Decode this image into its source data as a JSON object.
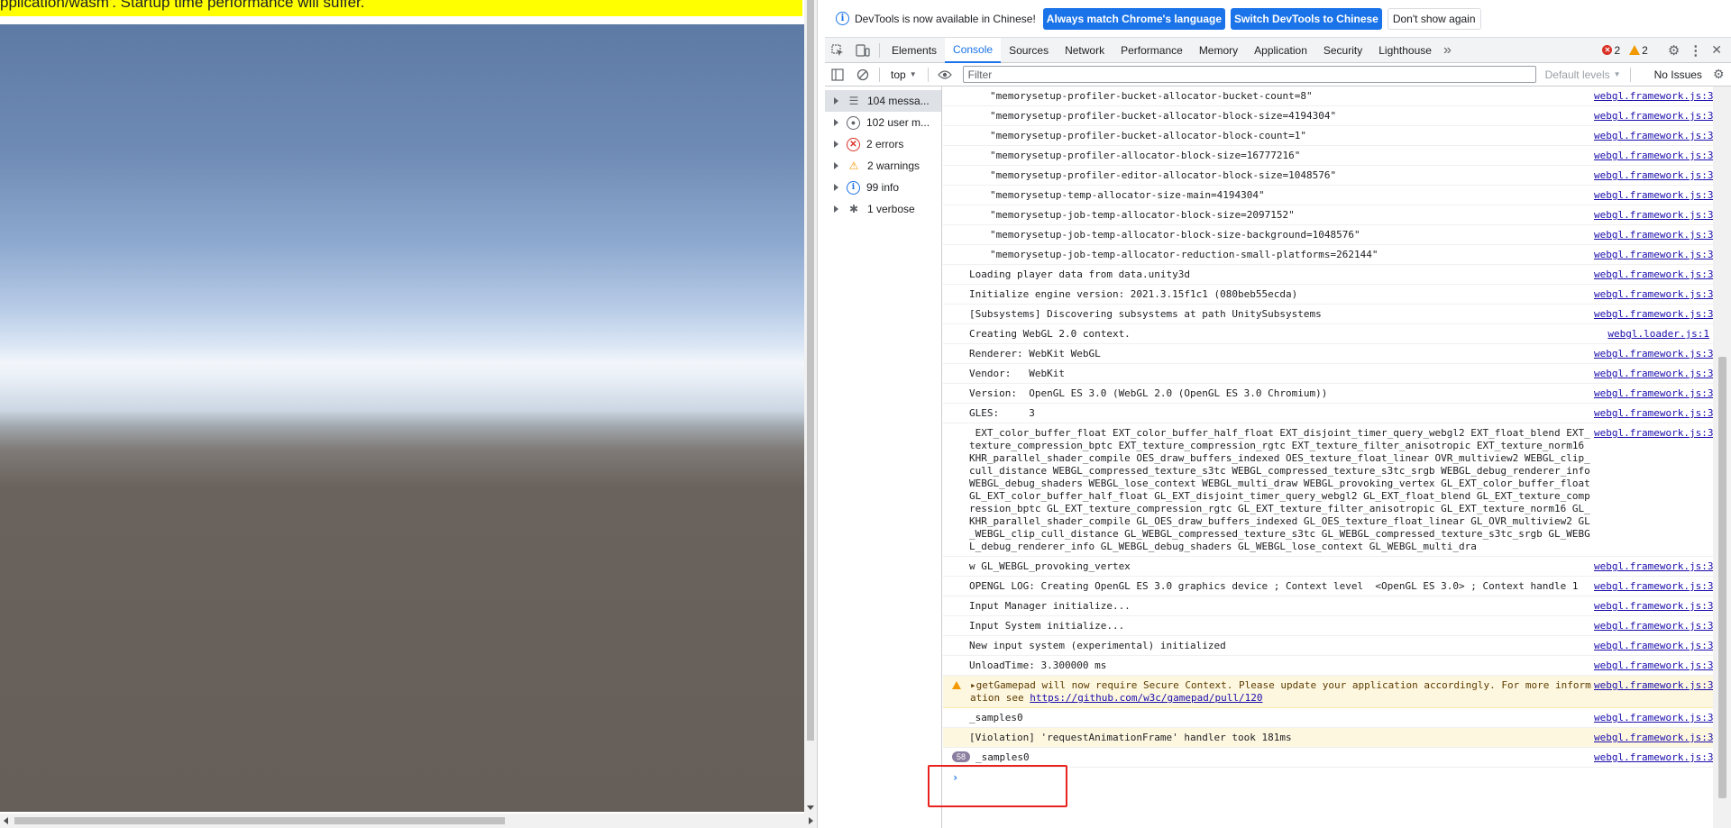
{
  "game": {
    "warning_text": "pplication/wasm'. Startup time performance will suffer."
  },
  "infobar": {
    "message": "DevTools is now available in Chinese!",
    "btn_match": "Always match Chrome's language",
    "btn_switch": "Switch DevTools to Chinese",
    "btn_dismiss": "Don't show again"
  },
  "tabs": [
    "Elements",
    "Console",
    "Sources",
    "Network",
    "Performance",
    "Memory",
    "Application",
    "Security",
    "Lighthouse"
  ],
  "tab_overflow": "»",
  "error_count": "2",
  "warning_count": "2",
  "toolbar": {
    "context": "top",
    "filter_placeholder": "Filter",
    "levels": "Default levels",
    "issues": "No Issues"
  },
  "sidebar": [
    {
      "label": "104 messa...",
      "icon": "list-icon"
    },
    {
      "label": "102 user m...",
      "icon": "user-icon"
    },
    {
      "label": "2 errors",
      "icon": "error-icon"
    },
    {
      "label": "2 warnings",
      "icon": "warning-icon"
    },
    {
      "label": "99 info",
      "icon": "info-icon"
    },
    {
      "label": "1 verbose",
      "icon": "bug-icon"
    }
  ],
  "console": {
    "rows": [
      {
        "msg": "\"memorysetup-profiler-bucket-allocator-bucket-count=8\"",
        "src": "webgl.framework.js:3",
        "indent": true
      },
      {
        "msg": "\"memorysetup-profiler-bucket-allocator-block-size=4194304\"",
        "src": "webgl.framework.js:3",
        "indent": true
      },
      {
        "msg": "\"memorysetup-profiler-bucket-allocator-block-count=1\"",
        "src": "webgl.framework.js:3",
        "indent": true
      },
      {
        "msg": "\"memorysetup-profiler-allocator-block-size=16777216\"",
        "src": "webgl.framework.js:3",
        "indent": true
      },
      {
        "msg": "\"memorysetup-profiler-editor-allocator-block-size=1048576\"",
        "src": "webgl.framework.js:3",
        "indent": true
      },
      {
        "msg": "\"memorysetup-temp-allocator-size-main=4194304\"",
        "src": "webgl.framework.js:3",
        "indent": true
      },
      {
        "msg": "\"memorysetup-job-temp-allocator-block-size=2097152\"",
        "src": "webgl.framework.js:3",
        "indent": true
      },
      {
        "msg": "\"memorysetup-job-temp-allocator-block-size-background=1048576\"",
        "src": "webgl.framework.js:3",
        "indent": true
      },
      {
        "msg": "\"memorysetup-job-temp-allocator-reduction-small-platforms=262144\"",
        "src": "webgl.framework.js:3",
        "indent": true
      },
      {
        "msg": "Loading player data from data.unity3d",
        "src": "webgl.framework.js:3"
      },
      {
        "msg": "Initialize engine version: 2021.3.15f1c1 (080beb55ecda)",
        "src": "webgl.framework.js:3"
      },
      {
        "msg": "[Subsystems] Discovering subsystems at path UnitySubsystems",
        "src": "webgl.framework.js:3"
      },
      {
        "msg": "Creating WebGL 2.0 context.",
        "src": "webgl.loader.js:1"
      },
      {
        "msg": "Renderer: WebKit WebGL",
        "src": "webgl.framework.js:3"
      },
      {
        "msg": "Vendor:   WebKit",
        "src": "webgl.framework.js:3"
      },
      {
        "msg": "Version:  OpenGL ES 3.0 (WebGL 2.0 (OpenGL ES 3.0 Chromium))",
        "src": "webgl.framework.js:3"
      },
      {
        "msg": "GLES:     3",
        "src": "webgl.framework.js:3"
      },
      {
        "msg": " EXT_color_buffer_float EXT_color_buffer_half_float EXT_disjoint_timer_query_webgl2 EXT_float_blend EXT_texture_compression_bptc EXT_texture_compression_rgtc EXT_texture_filter_anisotropic EXT_texture_norm16 KHR_parallel_shader_compile OES_draw_buffers_indexed OES_texture_float_linear OVR_multiview2 WEBGL_clip_cull_distance WEBGL_compressed_texture_s3tc WEBGL_compressed_texture_s3tc_srgb WEBGL_debug_renderer_info WEBGL_debug_shaders WEBGL_lose_context WEBGL_multi_draw WEBGL_provoking_vertex GL_EXT_color_buffer_float GL_EXT_color_buffer_half_float GL_EXT_disjoint_timer_query_webgl2 GL_EXT_float_blend GL_EXT_texture_compression_bptc GL_EXT_texture_compression_rgtc GL_EXT_texture_filter_anisotropic GL_EXT_texture_norm16 GL_KHR_parallel_shader_compile GL_OES_draw_buffers_indexed GL_OES_texture_float_linear GL_OVR_multiview2 GL_WEBGL_clip_cull_distance GL_WEBGL_compressed_texture_s3tc GL_WEBGL_compressed_texture_s3tc_srgb GL_WEBGL_debug_renderer_info GL_WEBGL_debug_shaders GL_WEBGL_lose_context GL_WEBGL_multi_dra",
        "src": "webgl.framework.js:3"
      },
      {
        "msg": "w GL_WEBGL_provoking_vertex",
        "src": "webgl.framework.js:3"
      },
      {
        "msg": "OPENGL LOG: Creating OpenGL ES 3.0 graphics device ; Context level  <OpenGL ES 3.0> ; Context handle 1",
        "src": "webgl.framework.js:3"
      },
      {
        "msg": "Input Manager initialize...",
        "src": "webgl.framework.js:3"
      },
      {
        "msg": "Input System initialize...",
        "src": "webgl.framework.js:3"
      },
      {
        "msg": "New input system (experimental) initialized",
        "src": "webgl.framework.js:3"
      },
      {
        "msg": "UnloadTime: 3.300000 ms",
        "src": "webgl.framework.js:3"
      }
    ],
    "warning": {
      "msg": "getGamepad will now require Secure Context. Please update your application accordingly. For more information see ",
      "link": "https://github.com/w3c/gamepad/pull/120",
      "src": "webgl.framework.js:3"
    },
    "after_rows": [
      {
        "msg": "_samples0",
        "src": "webgl.framework.js:3",
        "type": "normal"
      },
      {
        "msg": "[Violation] 'requestAnimationFrame' handler took 181ms",
        "src": "webgl.framework.js:3",
        "type": "violation"
      },
      {
        "msg": "_samples0",
        "src": "webgl.framework.js:3",
        "type": "grouped",
        "count": "58"
      }
    ],
    "prompt": "›"
  }
}
